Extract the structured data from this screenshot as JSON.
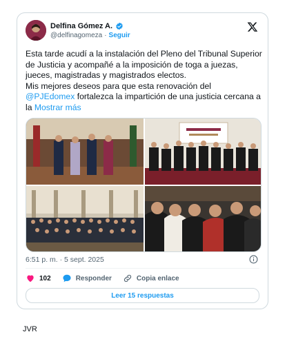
{
  "author": {
    "name": "Delfina Gómez A.",
    "handle": "@delfinagomeza",
    "separator": "·",
    "follow_label": "Seguir"
  },
  "tweet": {
    "line1": "Esta tarde acudí a la instalación del Pleno del Tribunal Superior de Justicia y acompañé a la imposición de toga a juezas, jueces, magistradas y magistrados electos.",
    "line2_before": "Mis mejores deseos para que esta renovación del",
    "mention": "@PJEdomex",
    "line2_after": " fortalezca la impartición de una justicia cercana a la ",
    "show_more": "Mostrar más"
  },
  "meta": {
    "timestamp": "6:51 p. m. · 5 sept. 2025"
  },
  "actions": {
    "likes": "102",
    "reply_label": "Responder",
    "copy_label": "Copia enlace"
  },
  "read_replies_label": "Leer 15 respuestas",
  "caption": "JVR",
  "colors": {
    "accent": "#1d9bf0",
    "like": "#f91880",
    "muted": "#536471"
  }
}
